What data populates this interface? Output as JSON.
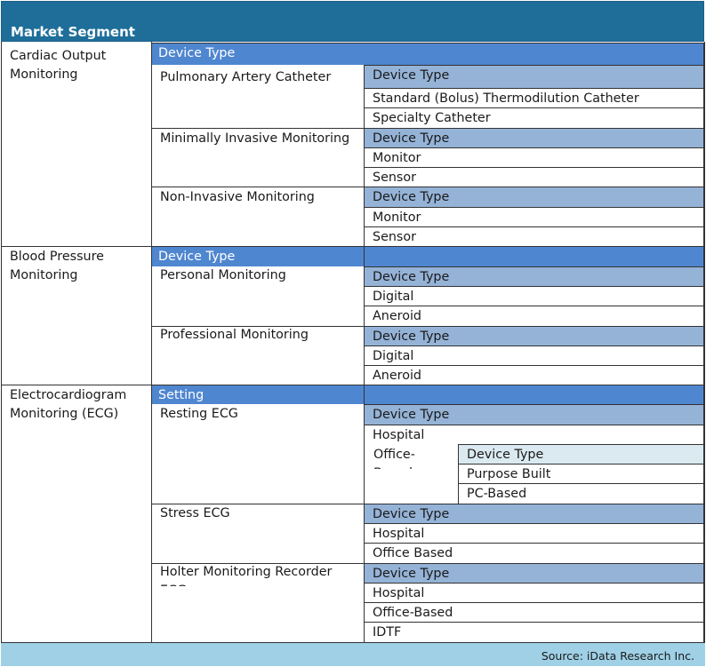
{
  "table": {
    "header": "Market Segment",
    "source": "Source: iData Research Inc.",
    "sections": [
      {
        "label": "Cardiac Output Monitoring",
        "band": "Device Type",
        "subs": [
          {
            "label": "Pulmonary Artery Catheter",
            "type_label": "Device Type",
            "items": [
              "Standard (Bolus) Thermodilution Catheter",
              "Specialty Catheter"
            ]
          },
          {
            "label": "Minimally Invasive Monitoring",
            "type_label": "Device Type",
            "items": [
              "Monitor",
              "Sensor"
            ]
          },
          {
            "label": "Non-Invasive Monitoring",
            "type_label": "Device Type",
            "items": [
              "Monitor",
              "Sensor"
            ]
          }
        ]
      },
      {
        "label": "Blood Pressure Monitoring",
        "band": "Device Type",
        "subs": [
          {
            "label": "Personal Monitoring",
            "type_label": "Device Type",
            "items": [
              "Digital",
              "Aneroid"
            ]
          },
          {
            "label": "Professional Monitoring",
            "type_label": "Device Type",
            "items": [
              "Digital",
              "Aneroid"
            ]
          }
        ]
      },
      {
        "label": "Electrocardiogram Monitoring (ECG)",
        "band": "Setting",
        "subs": [
          {
            "label": "Resting ECG",
            "type_label": "Device Type",
            "items": [
              "Hospital"
            ],
            "nested": {
              "label": "Office-Based",
              "type_label": "Device Type",
              "items": [
                "Purpose Built",
                "PC-Based"
              ]
            }
          },
          {
            "label": "Stress ECG",
            "type_label": "Device Type",
            "items": [
              "Hospital",
              "Office Based"
            ]
          },
          {
            "label": "Holter Monitoring Recorder ECG",
            "type_label": "Device Type",
            "items": [
              "Hospital",
              "Office-Based",
              "IDTF"
            ]
          }
        ]
      }
    ]
  }
}
